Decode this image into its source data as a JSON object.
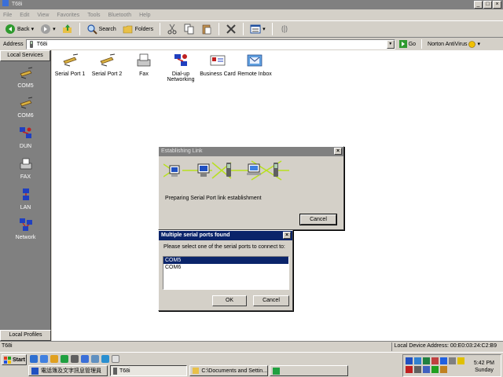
{
  "window": {
    "title": "T68i"
  },
  "menu": [
    "File",
    "Edit",
    "View",
    "Favorites",
    "Tools",
    "Bluetooth",
    "Help"
  ],
  "toolbar": {
    "back": "Back",
    "search": "Search",
    "folders": "Folders"
  },
  "address": {
    "label": "Address",
    "value": "T68i",
    "go": "Go",
    "norton": "Norton AntiVirus"
  },
  "sidebar": {
    "header": "Local Services",
    "footer": "Local Profiles",
    "items": [
      {
        "label": "COM5",
        "icon": "serial-port-icon"
      },
      {
        "label": "COM6",
        "icon": "serial-port-icon"
      },
      {
        "label": "DUN",
        "icon": "dial-up-icon"
      },
      {
        "label": "FAX",
        "icon": "fax-icon"
      },
      {
        "label": "LAN",
        "icon": "lan-icon"
      },
      {
        "label": "Network",
        "icon": "network-icon"
      }
    ]
  },
  "services": [
    {
      "label": "Serial Port 1",
      "icon": "serial-port-icon"
    },
    {
      "label": "Serial Port 2",
      "icon": "serial-port-icon"
    },
    {
      "label": "Fax",
      "icon": "fax-icon"
    },
    {
      "label": "Dial-up Networking",
      "line1": "Dial-up",
      "line2": "Networking",
      "icon": "dial-up-icon"
    },
    {
      "label": "Business Card",
      "icon": "business-card-icon"
    },
    {
      "label": "Remote Inbox",
      "icon": "inbox-icon"
    }
  ],
  "link_dialog": {
    "title": "Establishing Link",
    "message": "Preparing Serial Port link establishment",
    "cancel": "Cancel"
  },
  "ports_dialog": {
    "title": "Multiple serial ports found",
    "prompt": "Please select one of the serial ports to connect to:",
    "options": [
      "COM5",
      "COM6"
    ],
    "selected": "COM5",
    "ok": "OK",
    "cancel": "Cancel"
  },
  "status": {
    "left": "T68i",
    "right": "Local Device Address: 00:E0:03:24:C2:B9"
  },
  "taskbar": {
    "start": "Start",
    "tasks": [
      "電話簿及文字訊息管理員",
      "T68i",
      "C:\\Documents and Settin...",
      ""
    ],
    "time": "5:42 PM",
    "day": "Sunday"
  },
  "colors": {
    "title_active": "#0a246a",
    "title_inactive": "#808080",
    "sidebar_bg": "#808080",
    "face": "#d4d0c8"
  }
}
